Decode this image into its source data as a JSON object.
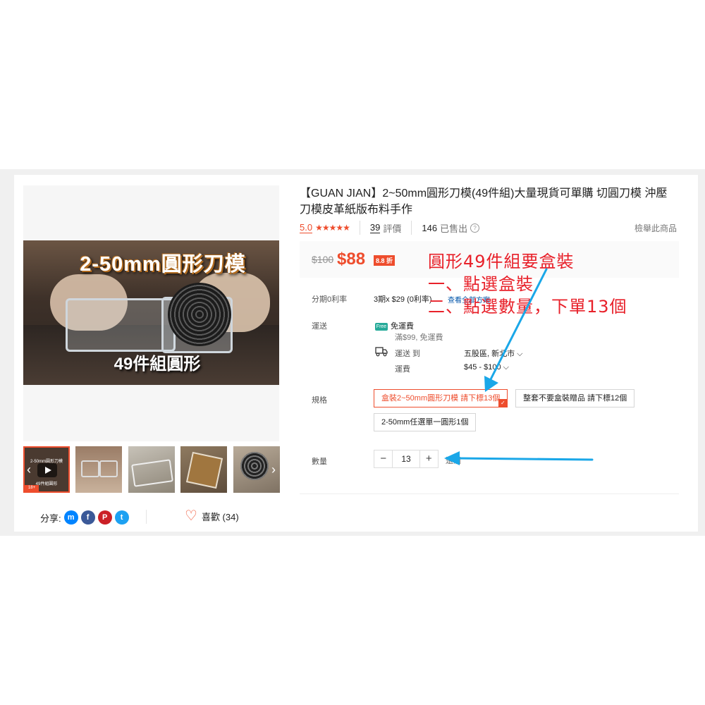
{
  "gallery": {
    "video_title": "2-50mm圓形刀模",
    "video_caption": "49件組圓形",
    "thumb1_title": "2-50mm圓形刀模",
    "thumb1_sub": "49件組圓形",
    "thumb_badge": "18+",
    "prev_arrow": "‹",
    "next_arrow": "›"
  },
  "share": {
    "label": "分享:",
    "icons": [
      "messenger-icon",
      "facebook-icon",
      "pinterest-icon",
      "twitter-icon"
    ]
  },
  "like": {
    "label": "喜歡 (34)"
  },
  "product": {
    "title": "【GUAN JIAN】2~50mm圓形刀模(49件組)大量現貨可單購 切圓刀模 沖壓刀模皮革紙版布料手作",
    "rating": "5.0",
    "stars": "★★★★★",
    "reviews_count": "39",
    "reviews_label": "評價",
    "sold_count": "146",
    "sold_label": "已售出",
    "help": "?",
    "report": "檢舉此商品"
  },
  "price": {
    "original": "$100",
    "current": "$88",
    "discount": "8.8 折"
  },
  "installment": {
    "label": "分期0利率",
    "value": "3期x $29 (0利率)",
    "link": "查看全部方案"
  },
  "shipping": {
    "label": "運送",
    "free_tag": "Free",
    "free_label": "免運費",
    "free_note": "滿$99, 免運費",
    "to_label": "運送 到",
    "to_value": "五股區, 新北市 ⌵",
    "fee_label": "運費",
    "fee_value": "$45 - $100 ⌵"
  },
  "variants": {
    "label": "規格",
    "options": [
      "盒裝2~50mm圓形刀模 請下標13個",
      "整套不要盒裝贈品 請下標12個",
      "2-50mm任選單一圓形1個"
    ],
    "selected_index": 0
  },
  "quantity": {
    "label": "數量",
    "minus": "−",
    "value": "13",
    "plus": "+",
    "stock_note": "還剩"
  },
  "annotations": {
    "line1": "圓形49件組要盒裝",
    "line2": "一、點選盒裝",
    "line3": "二、點選數量，下單13個",
    "color": "#e8212a",
    "arrow_color": "#1aa7e8"
  },
  "colors": {
    "accent": "#ee4d2d",
    "messenger": "#0084ff",
    "facebook": "#3b5998",
    "pinterest": "#cb2027",
    "twitter": "#1da1f2"
  }
}
